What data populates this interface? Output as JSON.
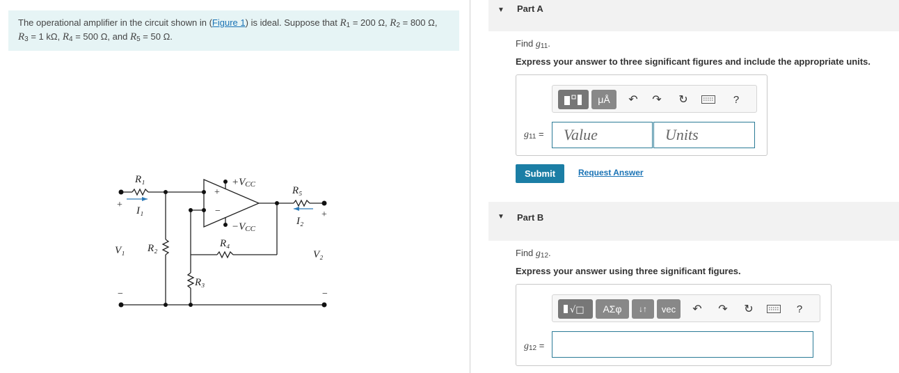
{
  "problem": {
    "text_before_link": "The operational amplifier in the circuit shown in (",
    "link": "Figure 1",
    "text_after_link": ") is ideal. Suppose that ",
    "r1_sym": "R",
    "r1_sub": "1",
    "r1_val": " = 200 Ω, ",
    "r2_sym": "R",
    "r2_sub": "2",
    "r2_val": " = 800 Ω,",
    "r3_sym": "R",
    "r3_sub": "3",
    "r3_val": " = 1 kΩ, ",
    "r4_sym": "R",
    "r4_sub": "4",
    "r4_val": " = 500 Ω, and ",
    "r5_sym": "R",
    "r5_sub": "5",
    "r5_val": " = 50 Ω."
  },
  "circuit": {
    "r1": "R₁",
    "i1": "I₁",
    "r2": "R₂",
    "r3": "R₃",
    "r4": "R₄",
    "r5": "R₅",
    "i2": "I₂",
    "v1": "V₁",
    "v2": "V₂",
    "vcc_pos": "+V",
    "vcc_neg": "−V",
    "vcc_sub": "CC",
    "plus": "+",
    "minus": "−"
  },
  "part_a": {
    "title": "Part A",
    "find_prefix": "Find ",
    "var": "g",
    "var_sub": "11",
    "find_suffix": ".",
    "instruction": "Express your answer to three significant figures and include the appropriate units.",
    "units_btn": "μÅ",
    "help": "?",
    "eq_var": "g",
    "eq_sub": "11",
    "eq_sign": " =",
    "value_placeholder": "Value",
    "units_placeholder": "Units",
    "submit": "Submit",
    "request": "Request Answer"
  },
  "part_b": {
    "title": "Part B",
    "find_prefix": "Find ",
    "var": "g",
    "var_sub": "12",
    "find_suffix": ".",
    "instruction": "Express your answer using three significant figures.",
    "sqrt_btn": "√□",
    "greek_btn": "ΑΣφ",
    "arrows_btn": "↓↑",
    "vec_btn": "vec",
    "help": "?",
    "eq_var": "g",
    "eq_sub": "12",
    "eq_sign": " ="
  }
}
